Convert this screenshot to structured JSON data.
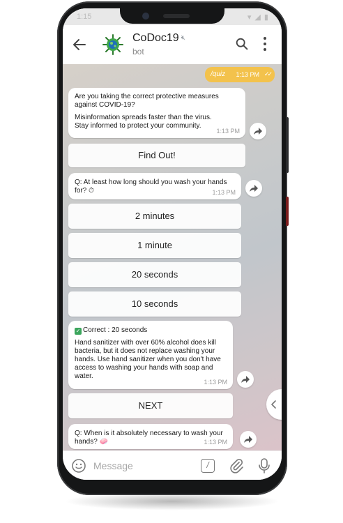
{
  "status": {
    "time": "1:15",
    "right": "▾ ◢ ▮"
  },
  "chat_header": {
    "title": "CoDoc19",
    "subtitle": "bot"
  },
  "outgoing": {
    "text": "/quiz",
    "time": "1:13 PM",
    "ticks": "✓✓"
  },
  "messages": [
    {
      "lines": [
        "Are you taking the correct protective measures",
        "against COVID-19?",
        "",
        "Misinformation spreads faster than the virus.",
        "Stay informed to protect your community."
      ],
      "time": "1:13 PM"
    },
    {
      "lines": [
        "Q: At least how long should you wash your hands",
        "for? ⏱"
      ],
      "time": "1:13 PM"
    },
    {
      "lines": [
        "Correct : 20 seconds",
        "",
        "Hand sanitizer with over 60% alcohol does kill",
        "bacteria, but it does not replace washing your",
        "hands. Use hand sanitizer when you don't have",
        "access to washing your hands with soap and",
        "water."
      ],
      "time": "1:13 PM"
    },
    {
      "lines": [
        "Q: When is it absolutely necessary to wash your",
        "hands? 🧼"
      ],
      "time": "1:13 PM"
    }
  ],
  "buttons": {
    "find_out": "Find Out!",
    "opt1": "2 minutes",
    "opt2": "1 minute",
    "opt3": "20 seconds",
    "opt4": "10 seconds",
    "next": "NEXT"
  },
  "composer": {
    "placeholder": "Message",
    "command": "/"
  },
  "colors": {
    "outgoing": "#f3c24c",
    "correct_check": "#3ba55c"
  }
}
